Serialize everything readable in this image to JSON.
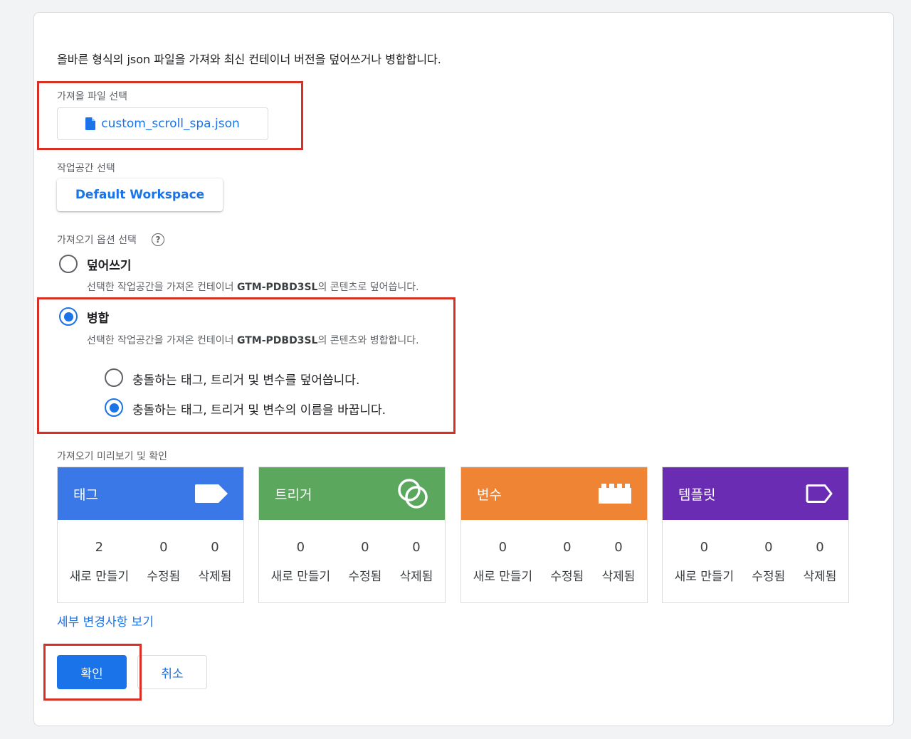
{
  "intro_text": "올바른 형식의 json 파일을 가져와 최신 컨테이너 버전을 덮어쓰거나 병합합니다.",
  "file_section": {
    "label": "가져올 파일 선택",
    "file_name": "custom_scroll_spa.json",
    "icon": "file-icon"
  },
  "workspace_section": {
    "label": "작업공간 선택",
    "button_label": "Default Workspace"
  },
  "options_section": {
    "label": "가져오기 옵션 선택",
    "help_icon": "?",
    "overwrite": {
      "title": "덮어쓰기",
      "desc_pre": "선택한 작업공간을 가져온 컨테이너 ",
      "container_id": "GTM-PDBD3SL",
      "desc_post": "의 콘텐츠로 덮어씁니다.",
      "selected": false
    },
    "merge": {
      "title": "병합",
      "desc_pre": "선택한 작업공간을 가져온 컨테이너 ",
      "container_id": "GTM-PDBD3SL",
      "desc_post": "의 콘텐츠와 병합합니다.",
      "selected": true
    },
    "conflict_options": [
      {
        "label": "충돌하는 태그, 트리거 및 변수를 덮어씁니다.",
        "selected": false
      },
      {
        "label": "충돌하는 태그, 트리거 및 변수의 이름을 바꿉니다.",
        "selected": true
      }
    ]
  },
  "preview_section": {
    "label": "가져오기 미리보기 및 확인",
    "tiles": [
      {
        "title": "태그",
        "color": "#3b78e7",
        "icon": "tag-icon",
        "stats": [
          {
            "value": "2",
            "label": "새로 만들기"
          },
          {
            "value": "0",
            "label": "수정됨"
          },
          {
            "value": "0",
            "label": "삭제됨"
          }
        ]
      },
      {
        "title": "트리거",
        "color": "#5aa75d",
        "icon": "trigger-icon",
        "stats": [
          {
            "value": "0",
            "label": "새로 만들기"
          },
          {
            "value": "0",
            "label": "수정됨"
          },
          {
            "value": "0",
            "label": "삭제됨"
          }
        ]
      },
      {
        "title": "변수",
        "color": "#ee8434",
        "icon": "variable-icon",
        "stats": [
          {
            "value": "0",
            "label": "새로 만들기"
          },
          {
            "value": "0",
            "label": "수정됨"
          },
          {
            "value": "0",
            "label": "삭제됨"
          }
        ]
      },
      {
        "title": "템플릿",
        "color": "#6b2cb4",
        "icon": "template-icon",
        "stats": [
          {
            "value": "0",
            "label": "새로 만들기"
          },
          {
            "value": "0",
            "label": "수정됨"
          },
          {
            "value": "0",
            "label": "삭제됨"
          }
        ]
      }
    ],
    "details_link": "세부 변경사항 보기"
  },
  "actions": {
    "confirm_label": "확인",
    "cancel_label": "취소"
  },
  "colors": {
    "accent": "#1a73e8",
    "highlight_box": "#d93025"
  }
}
